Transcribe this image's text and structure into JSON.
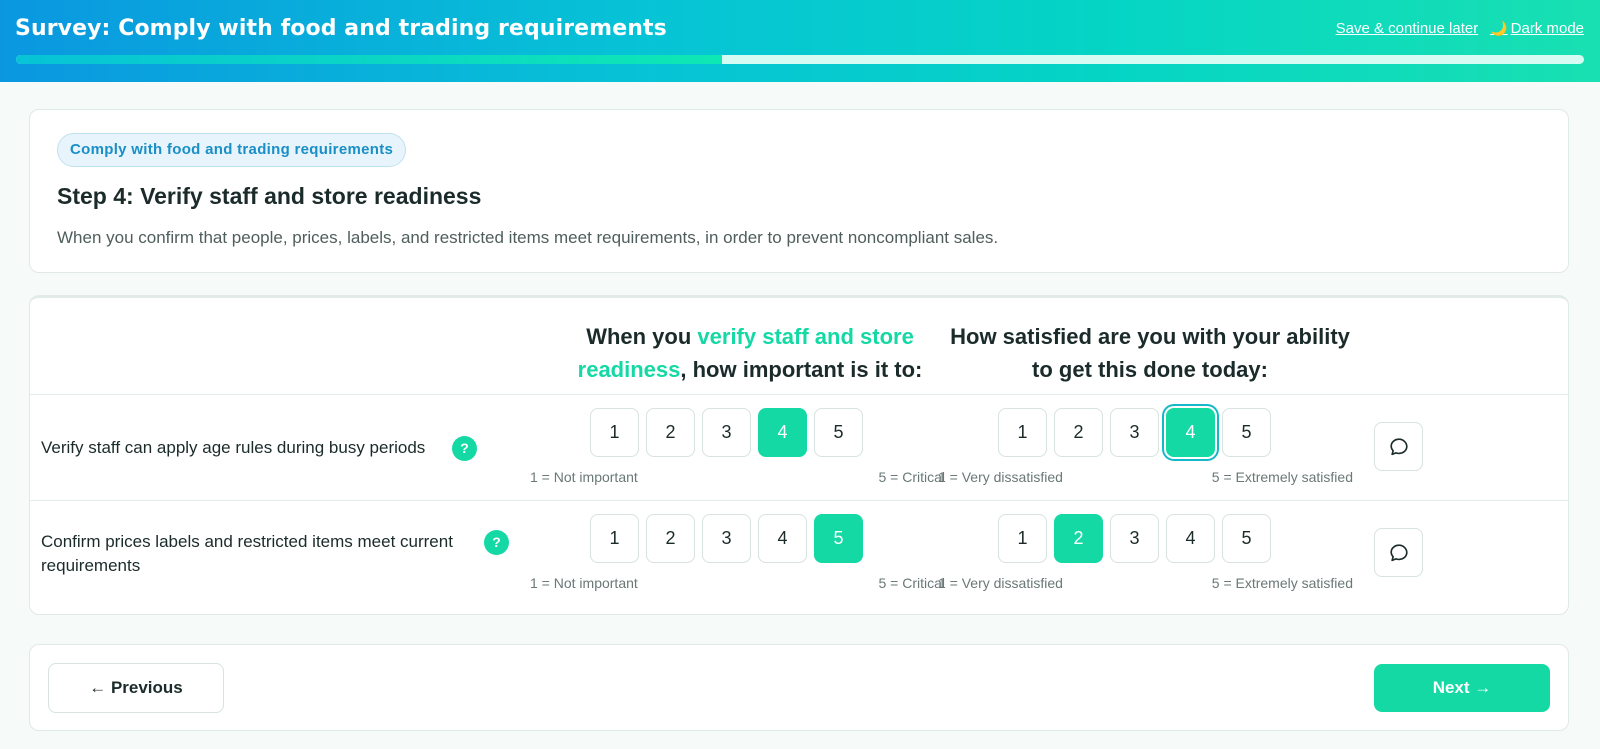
{
  "header": {
    "title": "Survey: Comply with food and trading requirements",
    "save_label": "Save & continue later",
    "dark_mode_icon": "moon-icon",
    "dark_mode_glyph": "🌙",
    "dark_mode_label": "Dark mode",
    "progress_fraction": 0.45
  },
  "intro": {
    "pill": "Comply with food and trading requirements",
    "step_title": "Step 4: Verify staff and store readiness",
    "description": "When you confirm that people, prices, labels, and restricted items meet requirements, in order to prevent noncompliant sales."
  },
  "matrix": {
    "importance_head_pre": "When you ",
    "importance_head_accent": "verify staff and store readiness",
    "importance_head_post": ", how important is it to:",
    "satisfaction_head": "How satisfied are you with your ability to get this done today:",
    "importance_min_hint": "1 = Not important",
    "importance_max_hint": "5 = Critical",
    "satisfaction_min_hint": "1 = Very dissatisfied",
    "satisfaction_max_hint": "5 = Extremely satisfied",
    "options": [
      "1",
      "2",
      "3",
      "4",
      "5"
    ],
    "rows": [
      {
        "label": "Verify staff can apply age rules during busy periods",
        "importance": 4,
        "satisfaction": 4,
        "focused": "satisfaction"
      },
      {
        "label": "Confirm prices labels and restricted items meet current requirements",
        "importance": 5,
        "satisfaction": 2,
        "focused": ""
      }
    ],
    "help_glyph": "?"
  },
  "nav": {
    "previous_label": "← Previous",
    "next_label": "Next →"
  },
  "colors": {
    "accent": "#14d9a5",
    "header_start": "#0a97e0",
    "header_end": "#19e0b2",
    "pill_text": "#1a8fc7"
  }
}
